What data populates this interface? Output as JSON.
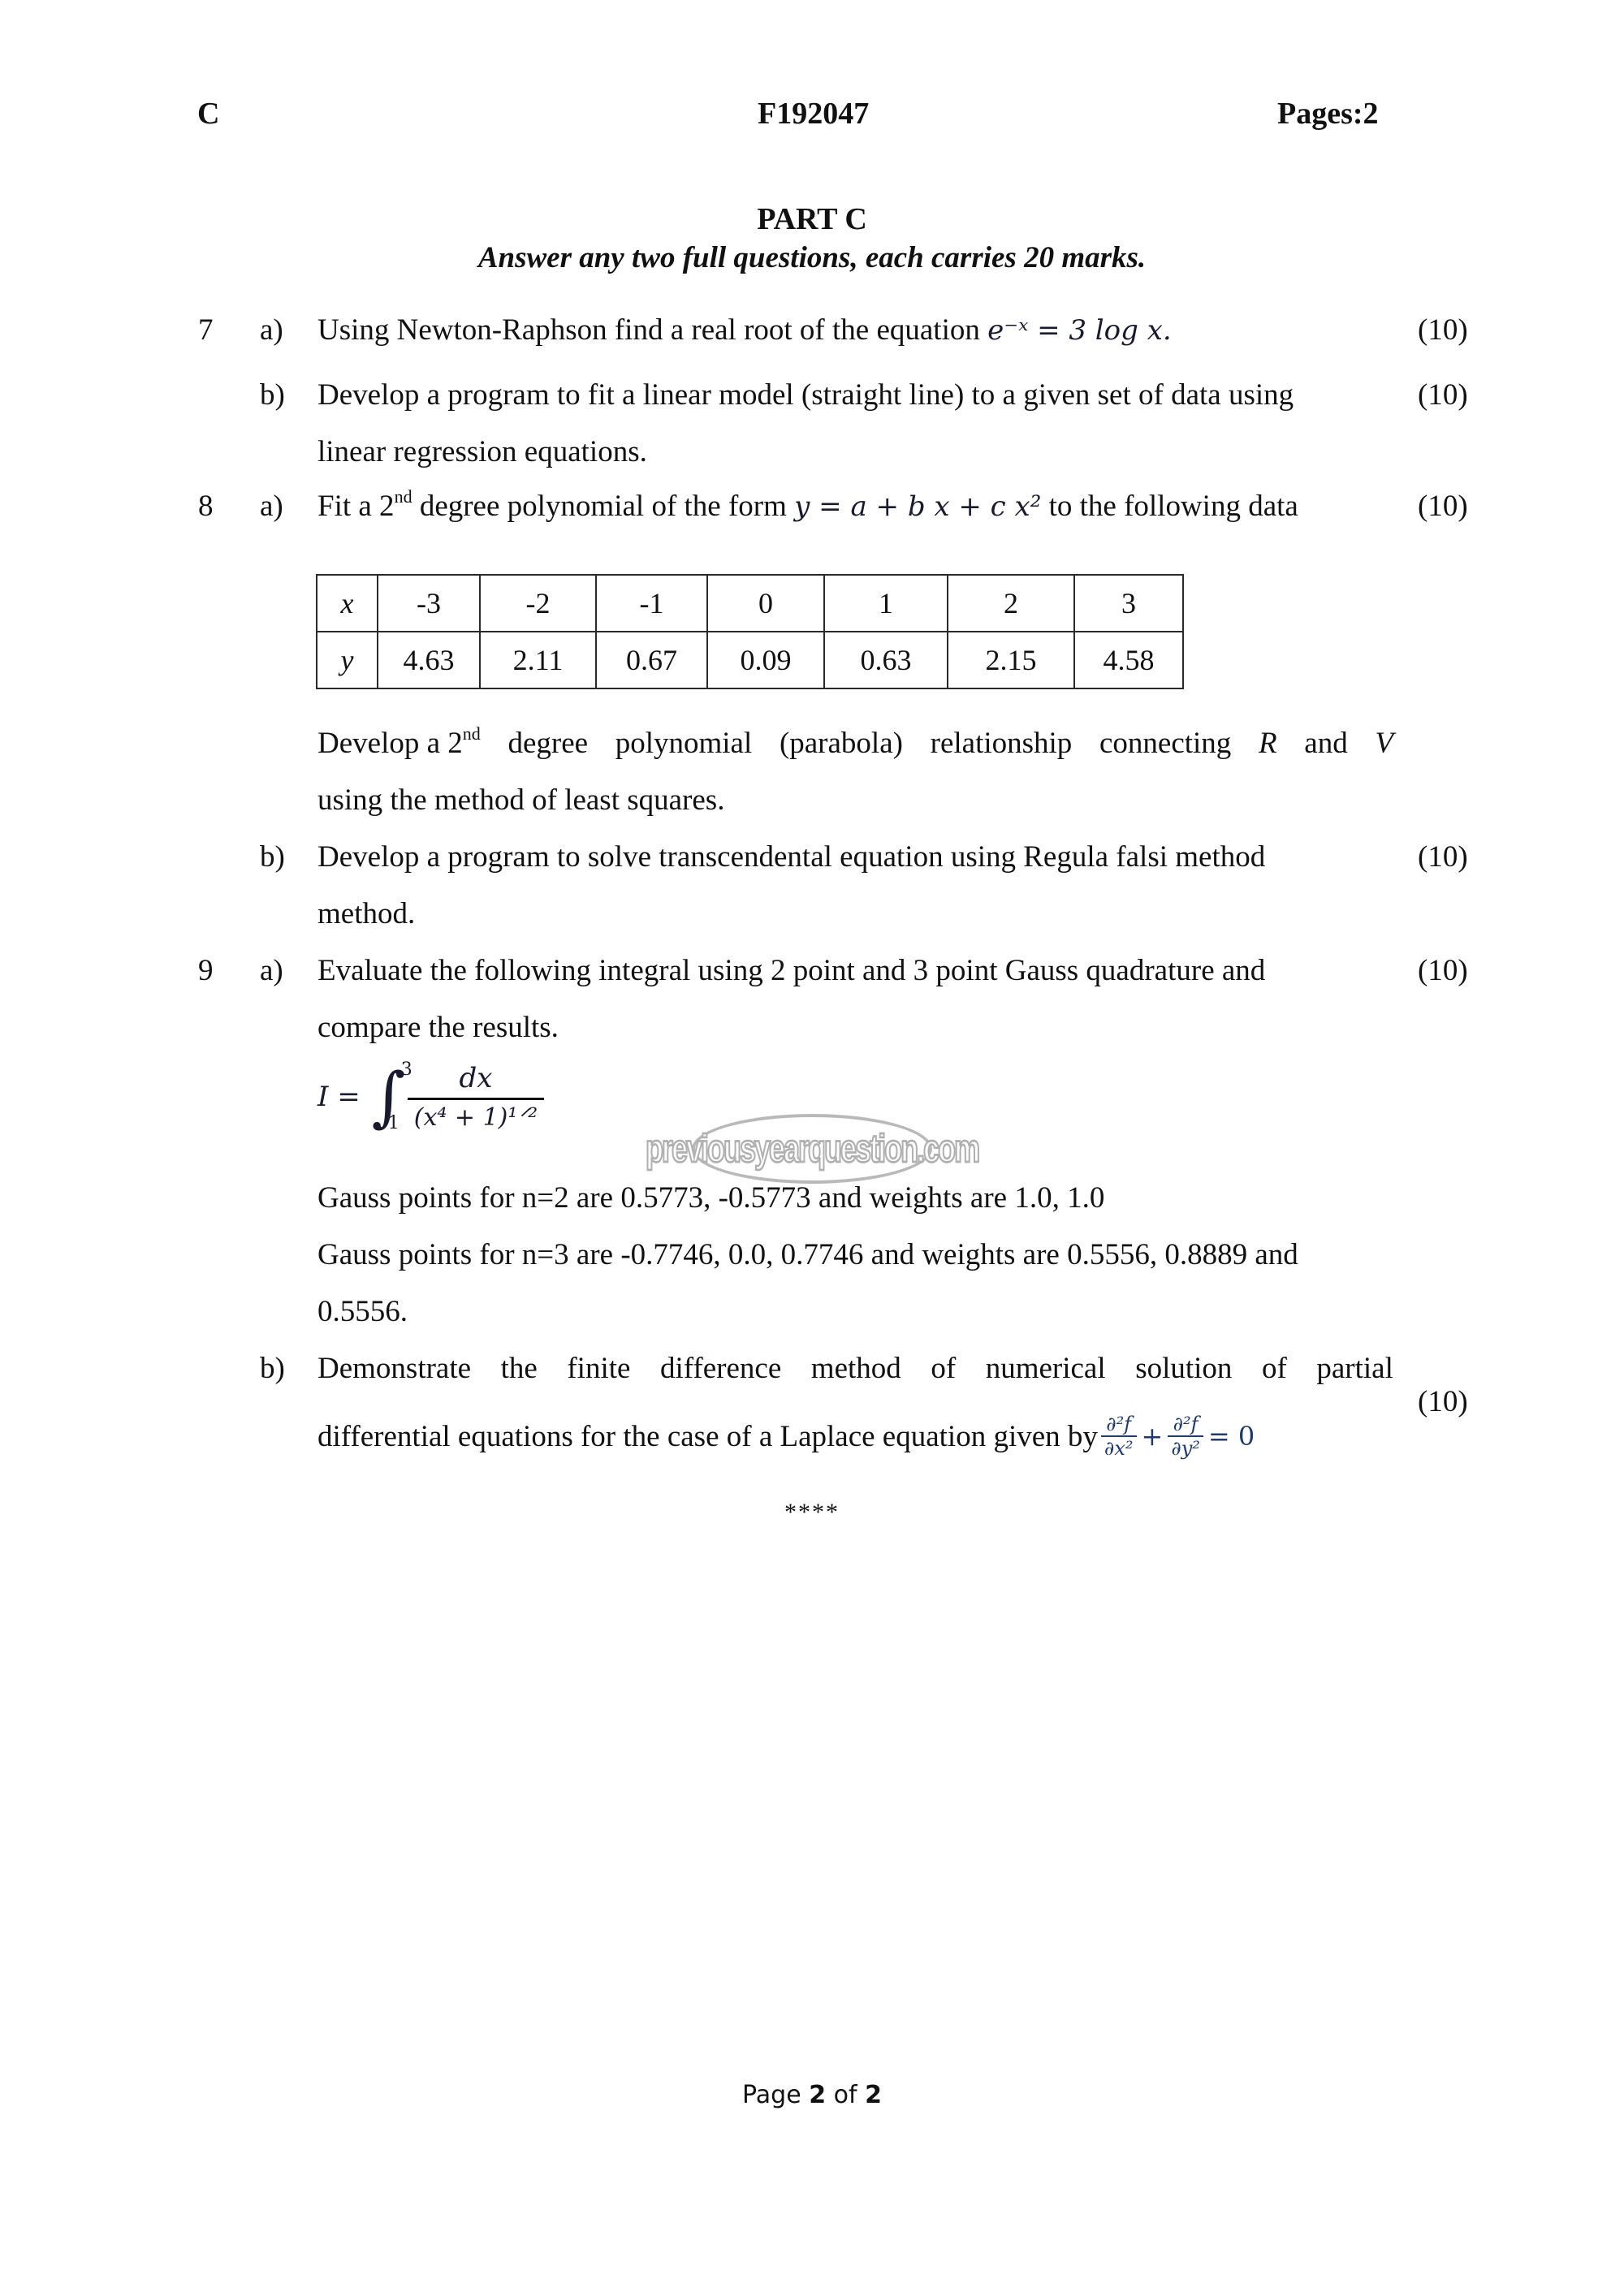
{
  "header": {
    "left": "C",
    "code": "F192047",
    "pages": "Pages:2"
  },
  "part": {
    "title": "PART C",
    "instruction": "Answer any two full questions, each carries 20 marks."
  },
  "questions": {
    "q7": {
      "number": "7",
      "a": {
        "label": "a)",
        "text": "Using Newton-Raphson find a real root of the equation",
        "equation": "e⁻ˣ = 3 log x.",
        "marks": "(10)"
      },
      "b": {
        "label": "b)",
        "line1": "Develop a program to fit a linear model (straight line) to a given set of data using",
        "line2": "linear regression equations.",
        "marks": "(10)"
      }
    },
    "q8": {
      "number": "8",
      "a": {
        "label": "a)",
        "text_pre": "Fit a 2",
        "ordinal": "nd",
        "text_mid": " degree polynomial of the form ",
        "equation": "y = a + b x + c x²",
        "text_post": " to the following data",
        "marks": "(10)",
        "table": {
          "x_label": "x",
          "y_label": "y",
          "x": [
            "-3",
            "-2",
            "-1",
            "0",
            "1",
            "2",
            "3"
          ],
          "y": [
            "4.63",
            "2.11",
            "0.67",
            "0.09",
            "0.63",
            "2.15",
            "4.58"
          ]
        },
        "follow_pre": "Develop a 2",
        "follow_ordinal": "nd",
        "follow_words": [
          "degree",
          "polynomial",
          "(parabola)",
          "relationship",
          "connecting",
          "R",
          "and",
          "V"
        ],
        "follow_line2": "using the method of least squares."
      },
      "b": {
        "label": "b)",
        "line1": "Develop a program to solve transcendental equation using Regula falsi method",
        "line2": "method.",
        "marks": "(10)"
      }
    },
    "q9": {
      "number": "9",
      "a": {
        "label": "a)",
        "line1": "Evaluate the following integral using 2 point and 3 point Gauss quadrature and",
        "line2": "compare the results.",
        "marks": "(10)",
        "integral": {
          "lhs": "I =",
          "lower": "1",
          "upper": "3",
          "numerator": "dx",
          "denominator": "(x⁴ + 1)¹ᐟ²"
        },
        "gauss2": "Gauss points for n=2 are 0.5773, -0.5773 and weights are 1.0, 1.0",
        "gauss3": "Gauss points for n=3 are -0.7746, 0.0, 0.7746 and weights are 0.5556, 0.8889 and",
        "gauss3_cont": "0.5556."
      },
      "b": {
        "label": "b)",
        "line1_words": [
          "Demonstrate",
          "the",
          "finite",
          "difference",
          "method",
          "of",
          "numerical",
          "solution",
          "of",
          "partial"
        ],
        "line2": "differential equations for the case of a Laplace equation given by",
        "eq": {
          "num1": "∂²f",
          "den1": "∂x²",
          "plus": "+",
          "num2": "∂²f",
          "den2": "∂y²",
          "rhs": "= 0"
        },
        "marks": "(10)"
      }
    }
  },
  "end_mark": "****",
  "watermark": "previousyearquestion.com",
  "footer": {
    "pre": "Page ",
    "current": "2",
    "mid": " of ",
    "total": "2"
  }
}
